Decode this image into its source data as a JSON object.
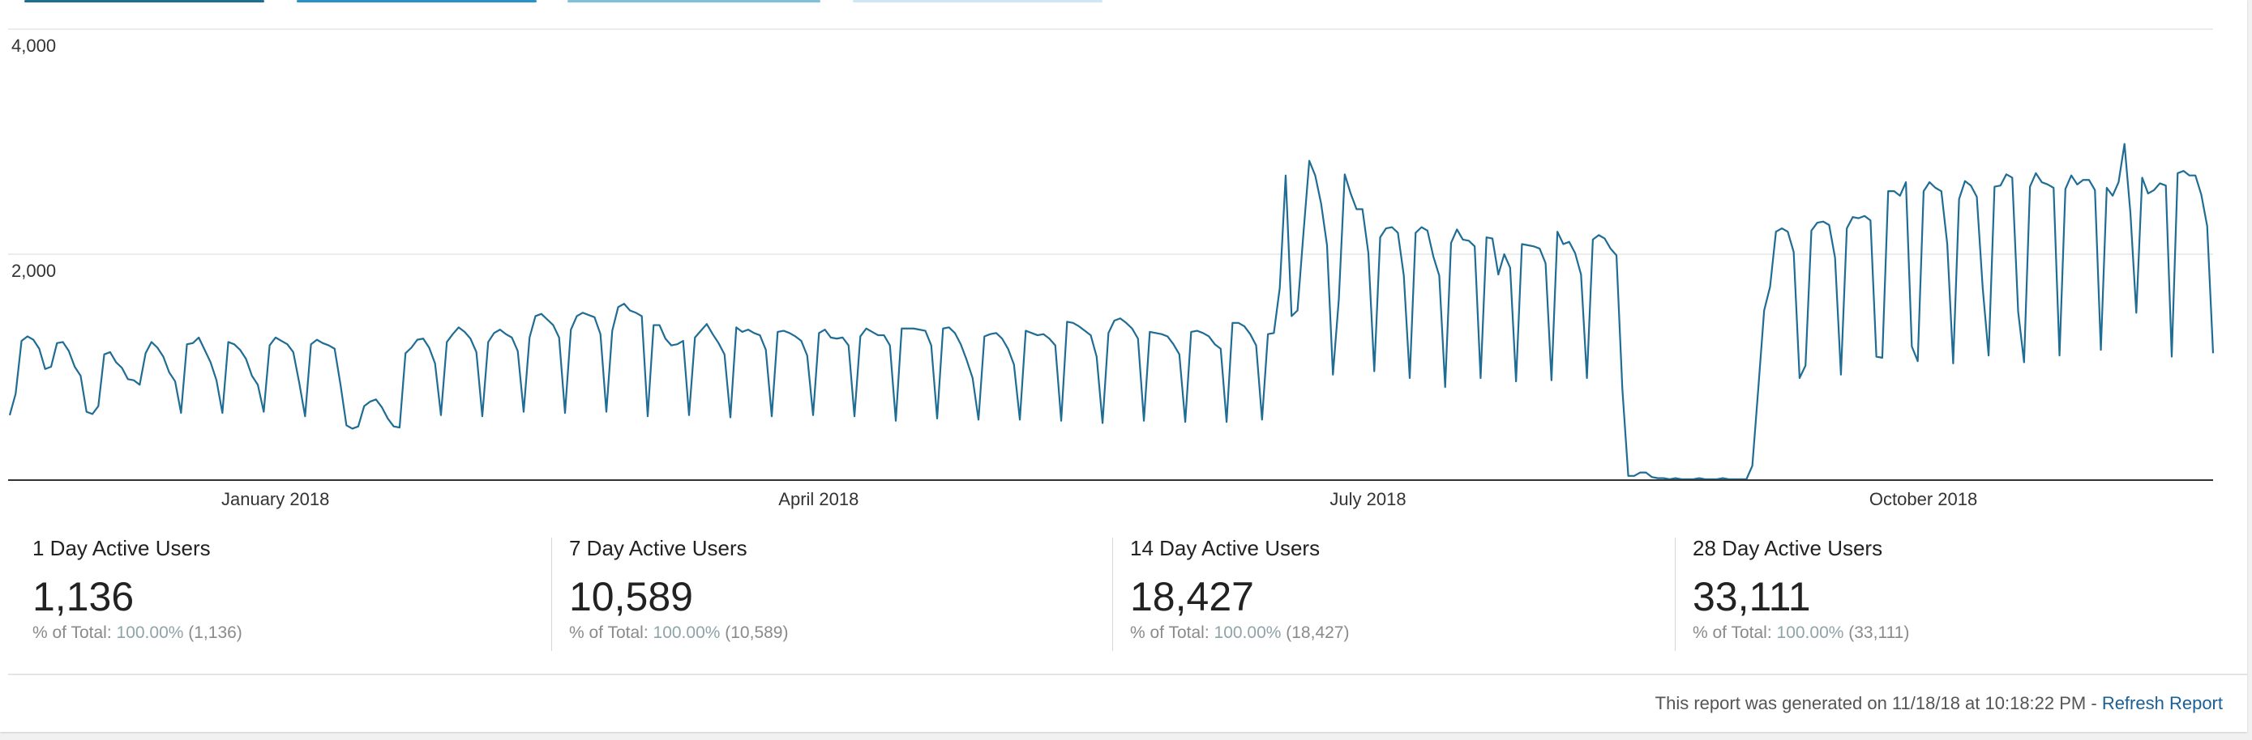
{
  "colors": {
    "line": "#1f6c94",
    "grid": "#e6e6e6",
    "axis": "#333333",
    "legend_swatches": [
      "#1e6f8f",
      "#2a93c5",
      "#7fc1dc",
      "#cfe7f2"
    ]
  },
  "chart_data": {
    "type": "line",
    "title": "",
    "xlabel": "",
    "ylabel": "",
    "ylim": [
      0,
      4000
    ],
    "y_ticks": [
      2000,
      4000
    ],
    "y_tick_labels": [
      "2,000",
      "4,000"
    ],
    "grid": true,
    "x_start": "2017-11-18",
    "x_end": "2018-11-18",
    "x_tick_labels": [
      {
        "date": "2018-01-01",
        "label": "January 2018"
      },
      {
        "date": "2018-04-01",
        "label": "April 2018"
      },
      {
        "date": "2018-07-01",
        "label": "July 2018"
      },
      {
        "date": "2018-10-01",
        "label": "October 2018"
      }
    ],
    "series": [
      {
        "name": "",
        "values": [
          570,
          760,
          1230,
          1270,
          1240,
          1160,
          980,
          1000,
          1210,
          1220,
          1140,
          1000,
          920,
          600,
          580,
          650,
          1110,
          1130,
          1040,
          990,
          890,
          880,
          840,
          1120,
          1220,
          1170,
          1090,
          950,
          870,
          590,
          1200,
          1210,
          1260,
          1150,
          1040,
          880,
          590,
          1220,
          1200,
          1150,
          1070,
          920,
          840,
          600,
          1190,
          1260,
          1230,
          1200,
          1130,
          860,
          560,
          1200,
          1240,
          1210,
          1190,
          1160,
          840,
          480,
          450,
          470,
          650,
          690,
          710,
          640,
          540,
          470,
          460,
          1120,
          1170,
          1240,
          1250,
          1170,
          1030,
          570,
          1220,
          1290,
          1350,
          1310,
          1250,
          1130,
          560,
          1220,
          1300,
          1330,
          1290,
          1260,
          1140,
          600,
          1260,
          1450,
          1470,
          1420,
          1370,
          1260,
          590,
          1330,
          1450,
          1480,
          1460,
          1440,
          1290,
          600,
          1320,
          1530,
          1560,
          1500,
          1480,
          1450,
          560,
          1370,
          1370,
          1250,
          1190,
          1200,
          1230,
          570,
          1260,
          1320,
          1380,
          1290,
          1210,
          1110,
          550,
          1350,
          1310,
          1330,
          1300,
          1280,
          1150,
          560,
          1310,
          1320,
          1300,
          1270,
          1230,
          1100,
          570,
          1300,
          1330,
          1260,
          1250,
          1260,
          1190,
          560,
          1270,
          1340,
          1310,
          1280,
          1280,
          1190,
          520,
          1340,
          1340,
          1340,
          1330,
          1320,
          1190,
          540,
          1340,
          1350,
          1300,
          1200,
          1060,
          900,
          530,
          1270,
          1290,
          1300,
          1250,
          1160,
          1020,
          530,
          1320,
          1300,
          1280,
          1290,
          1250,
          1190,
          520,
          1400,
          1390,
          1360,
          1320,
          1280,
          1090,
          500,
          1300,
          1410,
          1430,
          1390,
          1340,
          1250,
          520,
          1310,
          1300,
          1290,
          1270,
          1200,
          1110,
          510,
          1310,
          1320,
          1300,
          1270,
          1200,
          1160,
          510,
          1390,
          1390,
          1360,
          1290,
          1190,
          530,
          1290,
          1300,
          1700,
          2700,
          1450,
          1500,
          2180,
          2830,
          2700,
          2450,
          2080,
          930,
          1600,
          2710,
          2540,
          2400,
          2400,
          2010,
          960,
          2150,
          2230,
          2240,
          2190,
          1810,
          900,
          2190,
          2240,
          2210,
          1980,
          1810,
          820,
          2100,
          2220,
          2130,
          2120,
          2070,
          900,
          2150,
          2140,
          1820,
          2000,
          1880,
          870,
          2090,
          2080,
          2070,
          2050,
          1920,
          880,
          2200,
          2090,
          2110,
          2010,
          1820,
          900,
          2130,
          2170,
          2140,
          2050,
          1990,
          800,
          30,
          30,
          60,
          60,
          20,
          10,
          10,
          0,
          10,
          0,
          0,
          0,
          10,
          0,
          0,
          0,
          10,
          0,
          0,
          0,
          0,
          120,
          800,
          1500,
          1710,
          2200,
          2230,
          2200,
          2020,
          900,
          1010,
          2210,
          2280,
          2290,
          2260,
          1970,
          930,
          2230,
          2330,
          2320,
          2340,
          2300,
          1090,
          1080,
          2560,
          2560,
          2520,
          2640,
          1180,
          1050,
          2560,
          2640,
          2590,
          2560,
          2090,
          1030,
          2490,
          2650,
          2610,
          2510,
          1700,
          1100,
          2600,
          2610,
          2710,
          2680,
          1490,
          1040,
          2600,
          2720,
          2640,
          2620,
          2590,
          1100,
          2580,
          2700,
          2620,
          2660,
          2660,
          2570,
          1150,
          2590,
          2520,
          2640,
          2980,
          2370,
          1480,
          2680,
          2540,
          2570,
          2630,
          2610,
          1090,
          2720,
          2740,
          2700,
          2700,
          2530,
          2250,
          1120
        ]
      }
    ]
  },
  "metrics": [
    {
      "title": "1 Day Active Users",
      "value": "1,136",
      "sub_prefix": "% of Total: ",
      "sub_pct": "100.00%",
      "sub_suffix": " (1,136)"
    },
    {
      "title": "7 Day Active Users",
      "value": "10,589",
      "sub_prefix": "% of Total: ",
      "sub_pct": "100.00%",
      "sub_suffix": " (10,589)"
    },
    {
      "title": "14 Day Active Users",
      "value": "18,427",
      "sub_prefix": "% of Total: ",
      "sub_pct": "100.00%",
      "sub_suffix": " (18,427)"
    },
    {
      "title": "28 Day Active Users",
      "value": "33,111",
      "sub_prefix": "% of Total: ",
      "sub_pct": "100.00%",
      "sub_suffix": " (33,111)"
    }
  ],
  "footer": {
    "generated_text": "This report was generated on 11/18/18 at 10:18:22 PM - ",
    "refresh_label": "Refresh Report"
  }
}
